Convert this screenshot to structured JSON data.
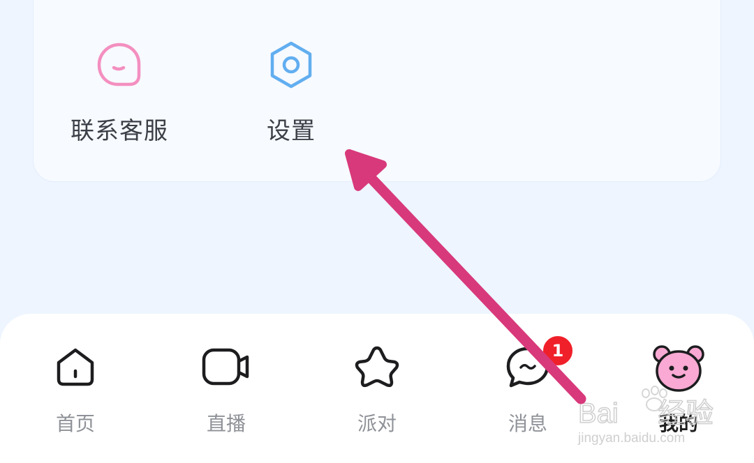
{
  "services": {
    "contact": {
      "label": "联系客服",
      "icon": "chat-bubble-face-icon",
      "color": "#f48fc0"
    },
    "settings": {
      "label": "设置",
      "icon": "settings-hexagon-icon",
      "color": "#62aef0"
    }
  },
  "tabs": [
    {
      "label": "首页",
      "icon": "home-icon"
    },
    {
      "label": "直播",
      "icon": "camera-icon"
    },
    {
      "label": "派对",
      "icon": "star-icon"
    },
    {
      "label": "消息",
      "icon": "message-icon",
      "badge": "1"
    },
    {
      "label": "我的",
      "icon": "bear-avatar-icon",
      "active": true
    }
  ],
  "watermark": {
    "brand": "Baidu经验",
    "url": "jingyan.baidu.com"
  },
  "colors": {
    "arrow": "#d8397a",
    "badge": "#f0202a",
    "active_tab_icon": "#f9a9d3"
  }
}
